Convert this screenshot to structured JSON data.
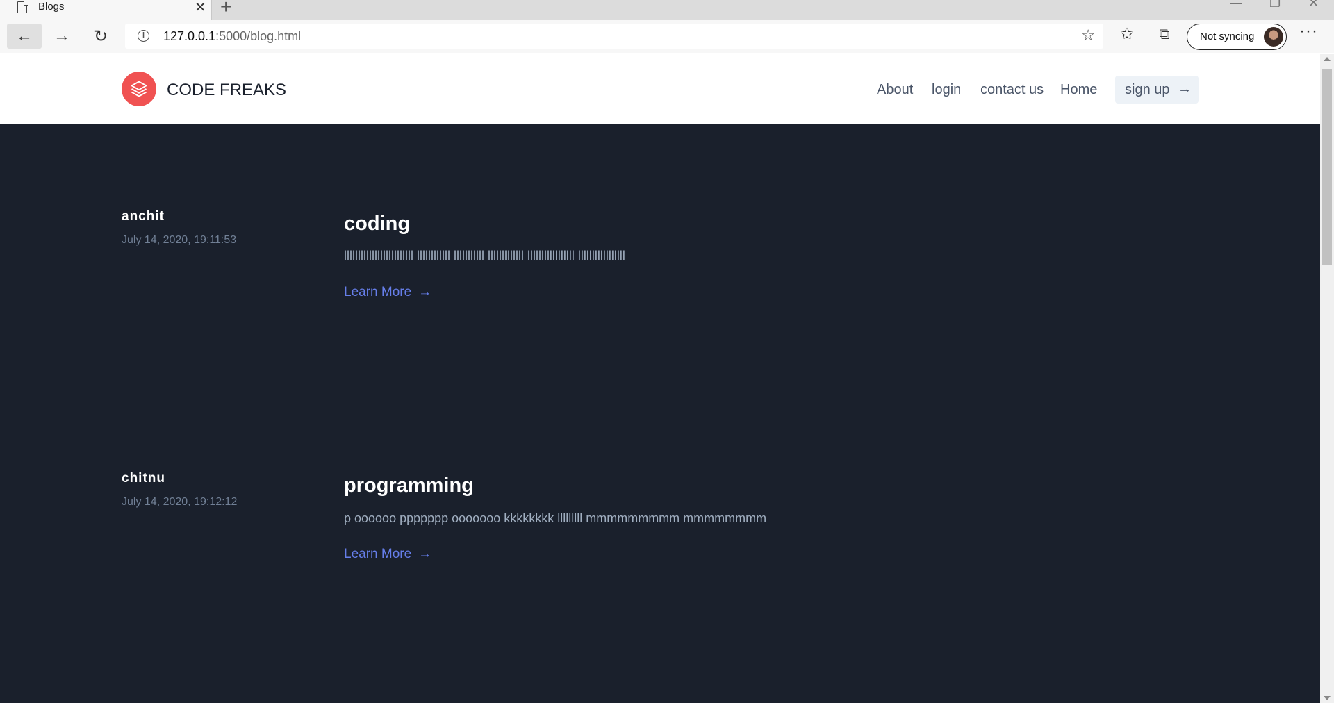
{
  "browser": {
    "tab_title": "Blogs",
    "tab_close": "✕",
    "new_tab": "+",
    "url_host": "127.0.0.1",
    "url_rest": ":5000/blog.html",
    "sync_label": "Not syncing",
    "more": "···"
  },
  "site": {
    "brand": "CODE FREAKS",
    "nav": [
      "About",
      "login",
      "contact us",
      "Home"
    ],
    "signup_label": "sign up",
    "accent_color": "#f05252",
    "background_color": "#1a202c",
    "link_color": "#667eea"
  },
  "posts": [
    {
      "author": "anchit",
      "date": "July 14, 2020, 19:11:53",
      "title": "coding",
      "body": "lllllllllllllllllllllllll llllllllllll lllllllllll lllllllllllll lllllllllllllllll lllllllllllllllll",
      "link": "Learn More"
    },
    {
      "author": "chitnu",
      "date": "July 14, 2020, 19:12:12",
      "title": "programming",
      "body": "p oooooo ppppppp ooooooo kkkkkkkk lllllllll mmmmmmmmm mmmmmmmm",
      "link": "Learn More"
    }
  ]
}
